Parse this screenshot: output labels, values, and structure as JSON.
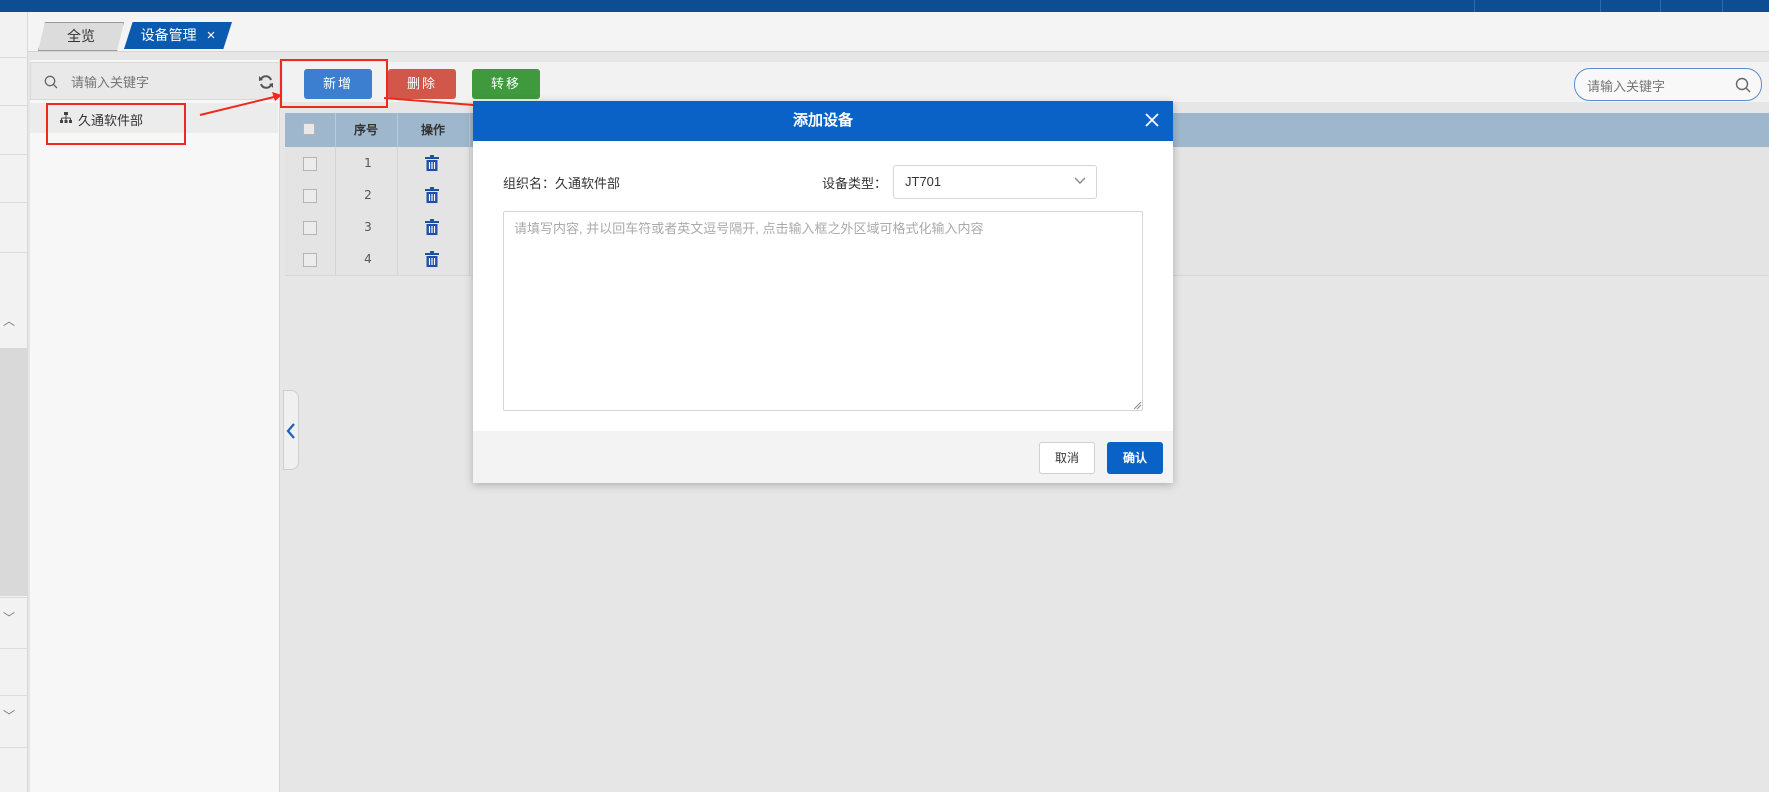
{
  "tabs": [
    {
      "label": "全览"
    },
    {
      "label": "设备管理",
      "close": "×"
    }
  ],
  "left_panel": {
    "search_placeholder": "请输入关键字",
    "tree_item": "久通软件部"
  },
  "toolbar": {
    "add_label": "新增",
    "delete_label": "删除",
    "move_label": "转移",
    "search_placeholder": "请输入关键字"
  },
  "table": {
    "headers": [
      "序号",
      "操作"
    ],
    "rows": [
      {
        "index": "1"
      },
      {
        "index": "2"
      },
      {
        "index": "3"
      },
      {
        "index": "4"
      }
    ]
  },
  "dialog": {
    "title": "添加设备",
    "org_label": "组织名：久通软件部",
    "type_label": "设备类型：",
    "type_value": "JT701",
    "textarea_placeholder": "请填写内容, 并以回车符或者英文逗号隔开, 点击输入框之外区域可格式化输入内容",
    "cancel_label": "取消",
    "confirm_label": "确认"
  },
  "colors": {
    "primary": "#0a62c6",
    "add": "#3c7fd0",
    "delete": "#d0574a",
    "move": "#3e9a3c",
    "annotation": "#ee2a1e"
  }
}
